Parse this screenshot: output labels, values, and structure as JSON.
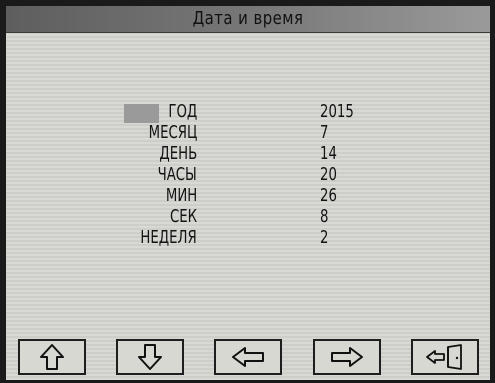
{
  "header": {
    "title": "Дата и время"
  },
  "fields": [
    {
      "label": "ГОД",
      "value": "2015"
    },
    {
      "label": "МЕСЯЦ",
      "value": "7"
    },
    {
      "label": "ДЕНЬ",
      "value": "14"
    },
    {
      "label": "ЧАСЫ",
      "value": "20"
    },
    {
      "label": "МИН",
      "value": "26"
    },
    {
      "label": "СЕК",
      "value": "8"
    },
    {
      "label": "НЕДЕЛЯ",
      "value": "2"
    }
  ],
  "toolbar": {
    "buttons": [
      {
        "icon": "arrow-up-icon"
      },
      {
        "icon": "arrow-down-icon"
      },
      {
        "icon": "arrow-left-icon"
      },
      {
        "icon": "arrow-right-icon"
      },
      {
        "icon": "exit-door-icon"
      }
    ]
  },
  "colors": {
    "screen_background": "#d4d4cf",
    "title_bar": "#6e6e6e",
    "selection_cursor": "#9a9a9a",
    "text": "#141414"
  }
}
